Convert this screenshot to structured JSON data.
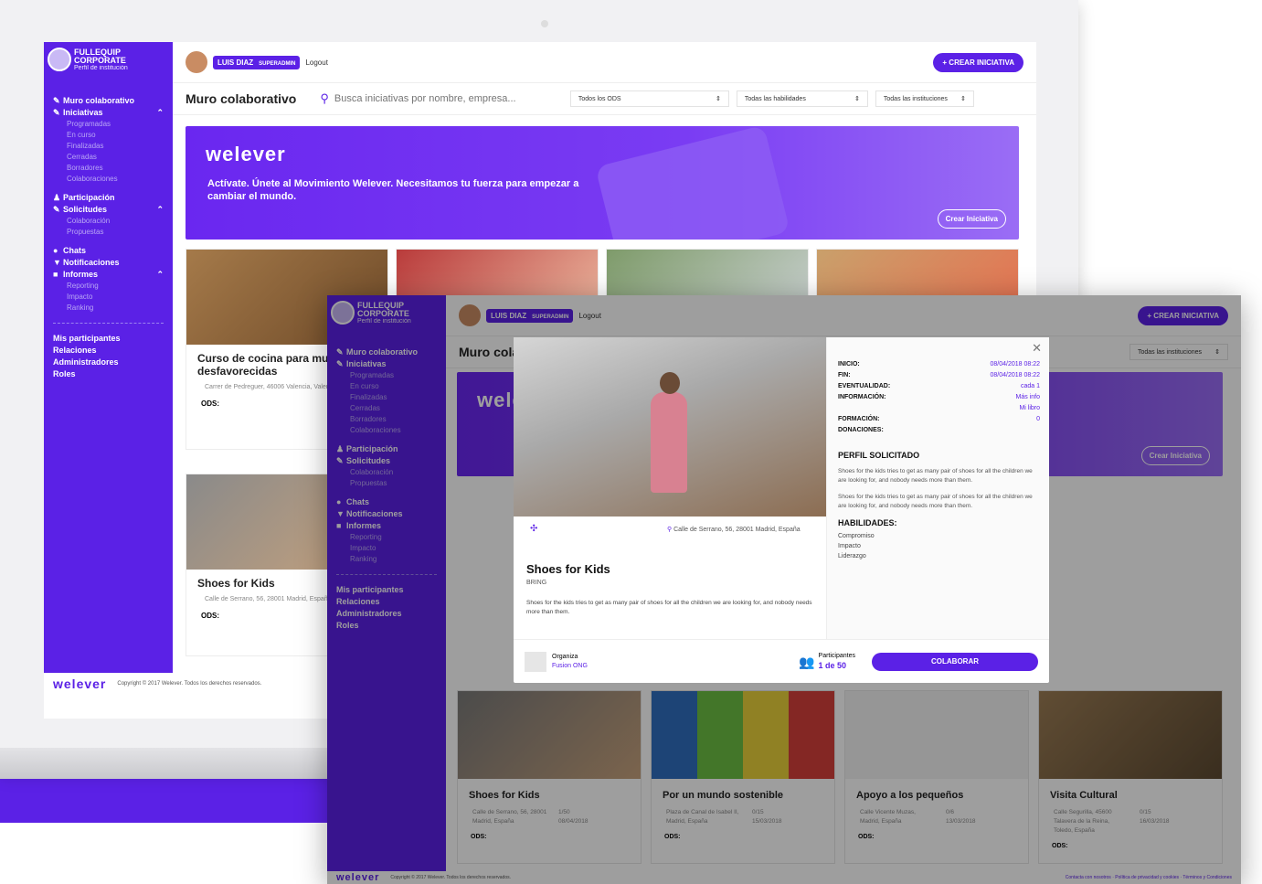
{
  "app": {
    "org_name_line1": "FULLEQUIP",
    "org_name_line2": "CORPORATE",
    "org_sub": "Perfil de institución",
    "user_name": "LUIS DIAZ",
    "user_role": "SUPERADMIN",
    "logout": "Logout",
    "create_button": "+ CREAR INICIATIVA"
  },
  "sidebar": {
    "items": [
      {
        "label": "Muro colaborativo"
      },
      {
        "label": "Iniciativas"
      },
      {
        "label": "Programadas"
      },
      {
        "label": "En curso"
      },
      {
        "label": "Finalizadas"
      },
      {
        "label": "Cerradas"
      },
      {
        "label": "Borradores"
      },
      {
        "label": "Colaboraciones"
      },
      {
        "label": "Participación"
      },
      {
        "label": "Solicitudes"
      },
      {
        "label": "Colaboración"
      },
      {
        "label": "Propuestas"
      },
      {
        "label": "Chats"
      },
      {
        "label": "Notificaciones"
      },
      {
        "label": "Informes"
      },
      {
        "label": "Reporting"
      },
      {
        "label": "Impacto"
      },
      {
        "label": "Ranking"
      },
      {
        "label": "Mis participantes"
      },
      {
        "label": "Relaciones"
      },
      {
        "label": "Administradores"
      },
      {
        "label": "Roles"
      }
    ]
  },
  "filters": {
    "title": "Muro colaborativo",
    "search_placeholder": "Busca iniciativas por nombre, empresa...",
    "ods": "Todos los ODS",
    "habilidades": "Todas las habilidades",
    "instituciones": "Todas las instituciones"
  },
  "hero": {
    "brand": "welever",
    "text": "Actívate. Únete al Movimiento Welever. Necesitamos tu fuerza para empezar a cambiar el mundo.",
    "button": "Crear Iniciativa"
  },
  "back_cards": [
    {
      "title": "Curso de cocina para mu desfavorecidas",
      "loc": "Carrer de Pedreguer, 46006 Valencia, Valencia, España",
      "ods": "ODS:"
    },
    {
      "title": "Shoes for Kids",
      "loc": "Calle de Serrano, 56, 28001 Madrid, España",
      "ods": "ODS:"
    }
  ],
  "footer": {
    "brand": "welever",
    "copyright": "Copyright © 2017 Welever. Todos los derechos reservados.",
    "links": "Contacta con nosotros · Política de privacidad y cookies · Términos y Condiciones"
  },
  "modal": {
    "inicio_label": "INICIO:",
    "inicio": "08/04/2018 08:22",
    "fin_label": "FIN:",
    "fin": "08/04/2018 08:22",
    "eventualidad_label": "EVENTUALIDAD:",
    "eventualidad": "cada 1",
    "informacion_label": "INFORMACIÓN:",
    "info1": "Más info",
    "info2": "Mi libro",
    "formacion_label": "FORMACIÓN:",
    "formacion": "0",
    "donaciones_label": "DONACIONES:",
    "perfil_title": "PERFIL SOLICITADO",
    "perfil_p1": "Shoes for the kids tries to get as many pair of shoes for all the children we are looking for, and nobody needs more than them.",
    "perfil_p2": "Shoes for the kids tries to get as many pair of shoes for all the children we are looking for, and nobody needs more than them.",
    "habilidades_title": "HABILIDADES:",
    "habilidades": [
      "Compromiso",
      "Impacto",
      "Liderazgo"
    ],
    "location": "Calle de Serrano, 56, 28001 Madrid, España",
    "title": "Shoes for Kids",
    "subtitle": "BRING",
    "description": "Shoes for the kids tries to get as many pair of shoes for all the children we are looking for, and nobody needs more than them.",
    "org_label": "Organiza",
    "org_name": "Fusion ONG",
    "participants_label": "Participantes",
    "participants": "1 de 50",
    "colaborar": "COLABORAR"
  },
  "front_cards": [
    {
      "title": "Shoes for Kids",
      "loc": "Calle de Serrano, 56, 28001 Madrid, España",
      "count": "1/50",
      "date": "08/04/2018",
      "ods": "ODS:"
    },
    {
      "title": "Por un mundo sostenible",
      "loc": "Plaza de Canal de Isabel II, Madrid, España",
      "count": "0/15",
      "date": "15/03/2018",
      "ods": "ODS:"
    },
    {
      "title": "Apoyo a los pequeños",
      "loc": "Calle Vicente Muzas, Madrid, España",
      "count": "0/6",
      "date": "13/03/2018",
      "ods": "ODS:"
    },
    {
      "title": "Visita Cultural",
      "loc": "Calle Segurilla, 45600 Talavera de la Reina, Toledo, España",
      "count": "0/15",
      "date": "16/03/2018",
      "ods": "ODS:"
    }
  ],
  "colors": {
    "accent": "#5b21e6"
  }
}
